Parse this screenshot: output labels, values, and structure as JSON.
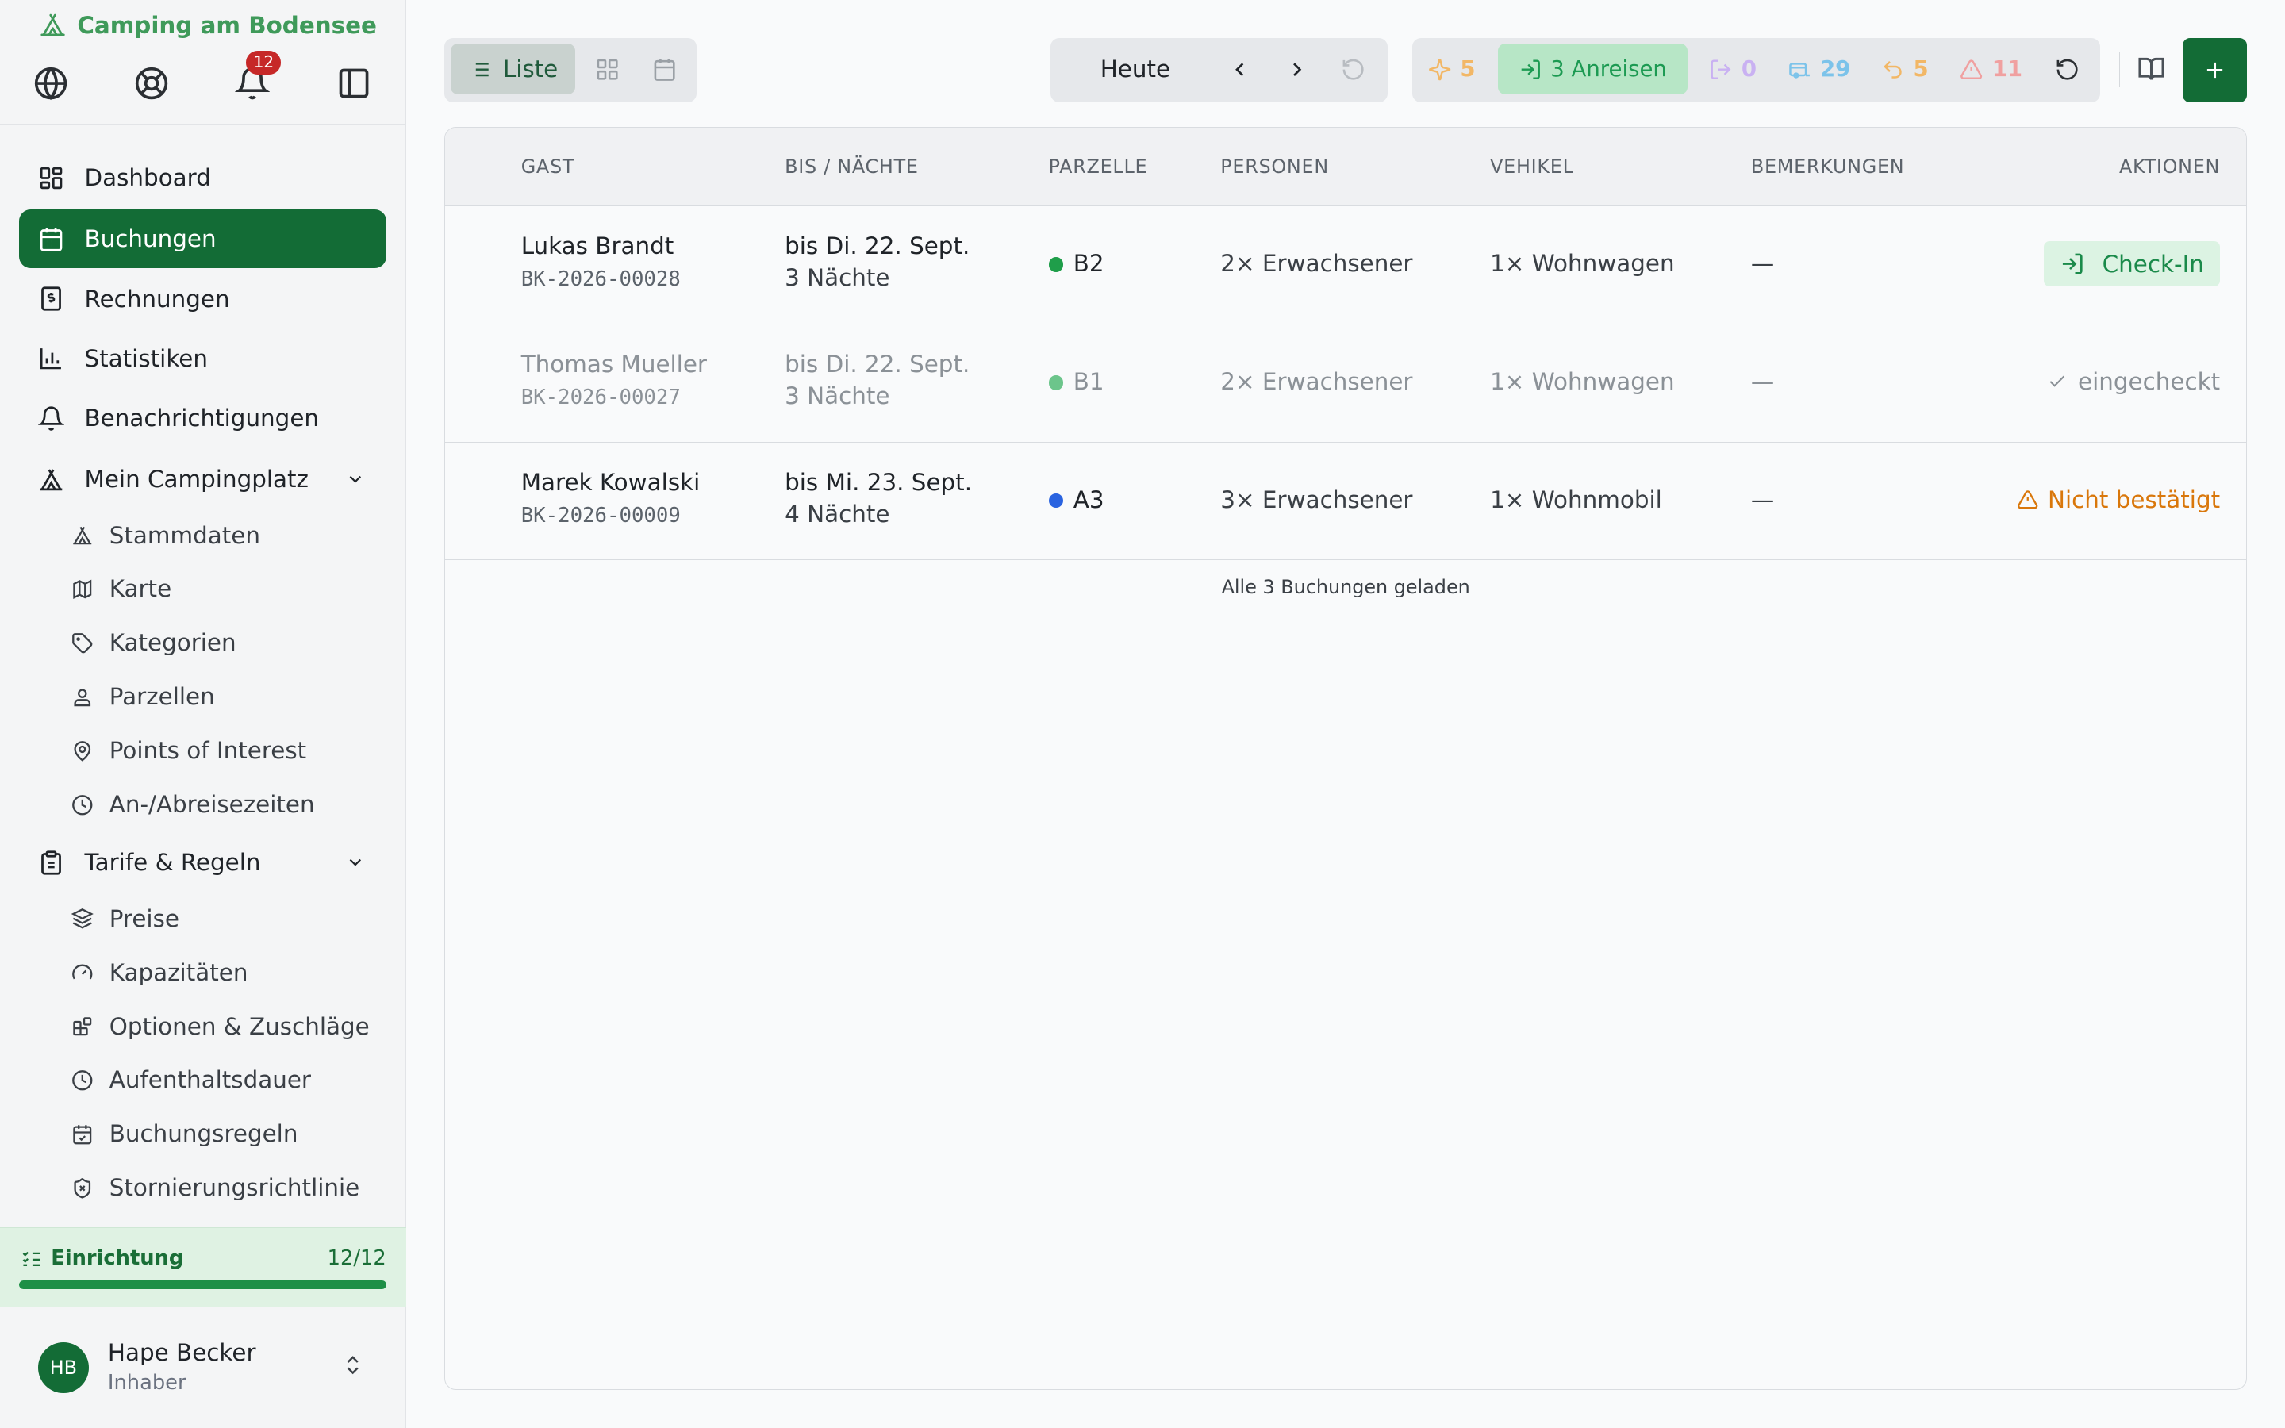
{
  "brand": {
    "name": "Camping am Bodensee"
  },
  "notifications": {
    "count": "12"
  },
  "nav": {
    "dashboard": "Dashboard",
    "buchungen": "Buchungen",
    "rechnungen": "Rechnungen",
    "statistiken": "Statistiken",
    "benachrichtigungen": "Benachrichtigungen",
    "mein_campingplatz": "Mein Campingplatz",
    "campingplatz_items": [
      "Stammdaten",
      "Karte",
      "Kategorien",
      "Parzellen",
      "Points of Interest",
      "An-/Abreisezeiten"
    ],
    "tarife": "Tarife & Regeln",
    "tarife_items": [
      "Preise",
      "Kapazitäten",
      "Optionen & Zuschläge",
      "Aufenthaltsdauer",
      "Buchungsregeln",
      "Stornierungsrichtlinie"
    ]
  },
  "setup": {
    "label": "Einrichtung",
    "count": "12/12",
    "progress": 1.0
  },
  "user": {
    "initials": "HB",
    "name": "Hape Becker",
    "role": "Inhaber"
  },
  "toolbar": {
    "view_list": "Liste",
    "today": "Heute",
    "stats": {
      "new": "5",
      "arrivals": "3 Anreisen",
      "departures": "0",
      "present": "29",
      "returns": "5",
      "warnings": "11"
    }
  },
  "table": {
    "headers": [
      "GAST",
      "BIS / NÄCHTE",
      "PARZELLE",
      "PERSONEN",
      "VEHIKEL",
      "BEMERKUNGEN",
      "AKTIONEN"
    ],
    "rows": [
      {
        "guest": "Lukas Brandt",
        "id": "BK-2026-00028",
        "until": "bis Di. 22. Sept.",
        "nights": "3 Nächte",
        "plot": "B2",
        "plot_color": "#1f9e4a",
        "persons": "2× Erwachsener",
        "vehicle": "1× Wohnwagen",
        "notes": "—",
        "action": "Check-In"
      },
      {
        "guest": "Thomas Mueller",
        "id": "BK-2026-00027",
        "until": "bis Di. 22. Sept.",
        "nights": "3 Nächte",
        "plot": "B1",
        "plot_color": "#6cc58b",
        "persons": "2× Erwachsener",
        "vehicle": "1× Wohnwagen",
        "notes": "—",
        "action": "eingecheckt"
      },
      {
        "guest": "Marek Kowalski",
        "id": "BK-2026-00009",
        "until": "bis Mi. 23. Sept.",
        "nights": "4 Nächte",
        "plot": "A3",
        "plot_color": "#2a63e0",
        "persons": "3× Erwachsener",
        "vehicle": "1× Wohnmobil",
        "notes": "—",
        "action": "Nicht bestätigt"
      }
    ],
    "footer": "Alle 3 Buchungen geladen"
  },
  "colors": {
    "primary": "#136c36",
    "accent_green": "#1a8a4a",
    "warning": "#d9770b",
    "danger": "#c62828"
  }
}
